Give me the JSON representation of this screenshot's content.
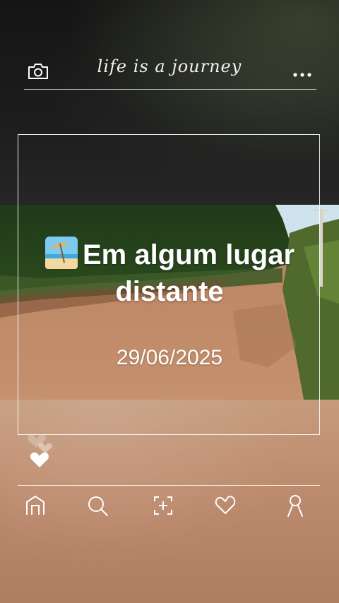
{
  "header": {
    "title": "life is a journey",
    "camera_icon": "camera-icon",
    "more_icon": "more-dots-icon"
  },
  "post": {
    "place_emoji": "beach-umbrella-emoji",
    "place": "Em algum lugar distante",
    "date": "29/06/2025"
  },
  "reactions": {
    "icon": "heart-icon"
  },
  "nav": {
    "items": [
      {
        "name": "home",
        "icon": "home-icon"
      },
      {
        "name": "search",
        "icon": "search-icon"
      },
      {
        "name": "add",
        "icon": "add-post-icon"
      },
      {
        "name": "likes",
        "icon": "heart-outline-icon"
      },
      {
        "name": "profile",
        "icon": "profile-icon"
      }
    ]
  },
  "colors": {
    "top_background": "#1b1b1b",
    "bottom_background": "#c4906e",
    "foreground": "#ffffff"
  }
}
